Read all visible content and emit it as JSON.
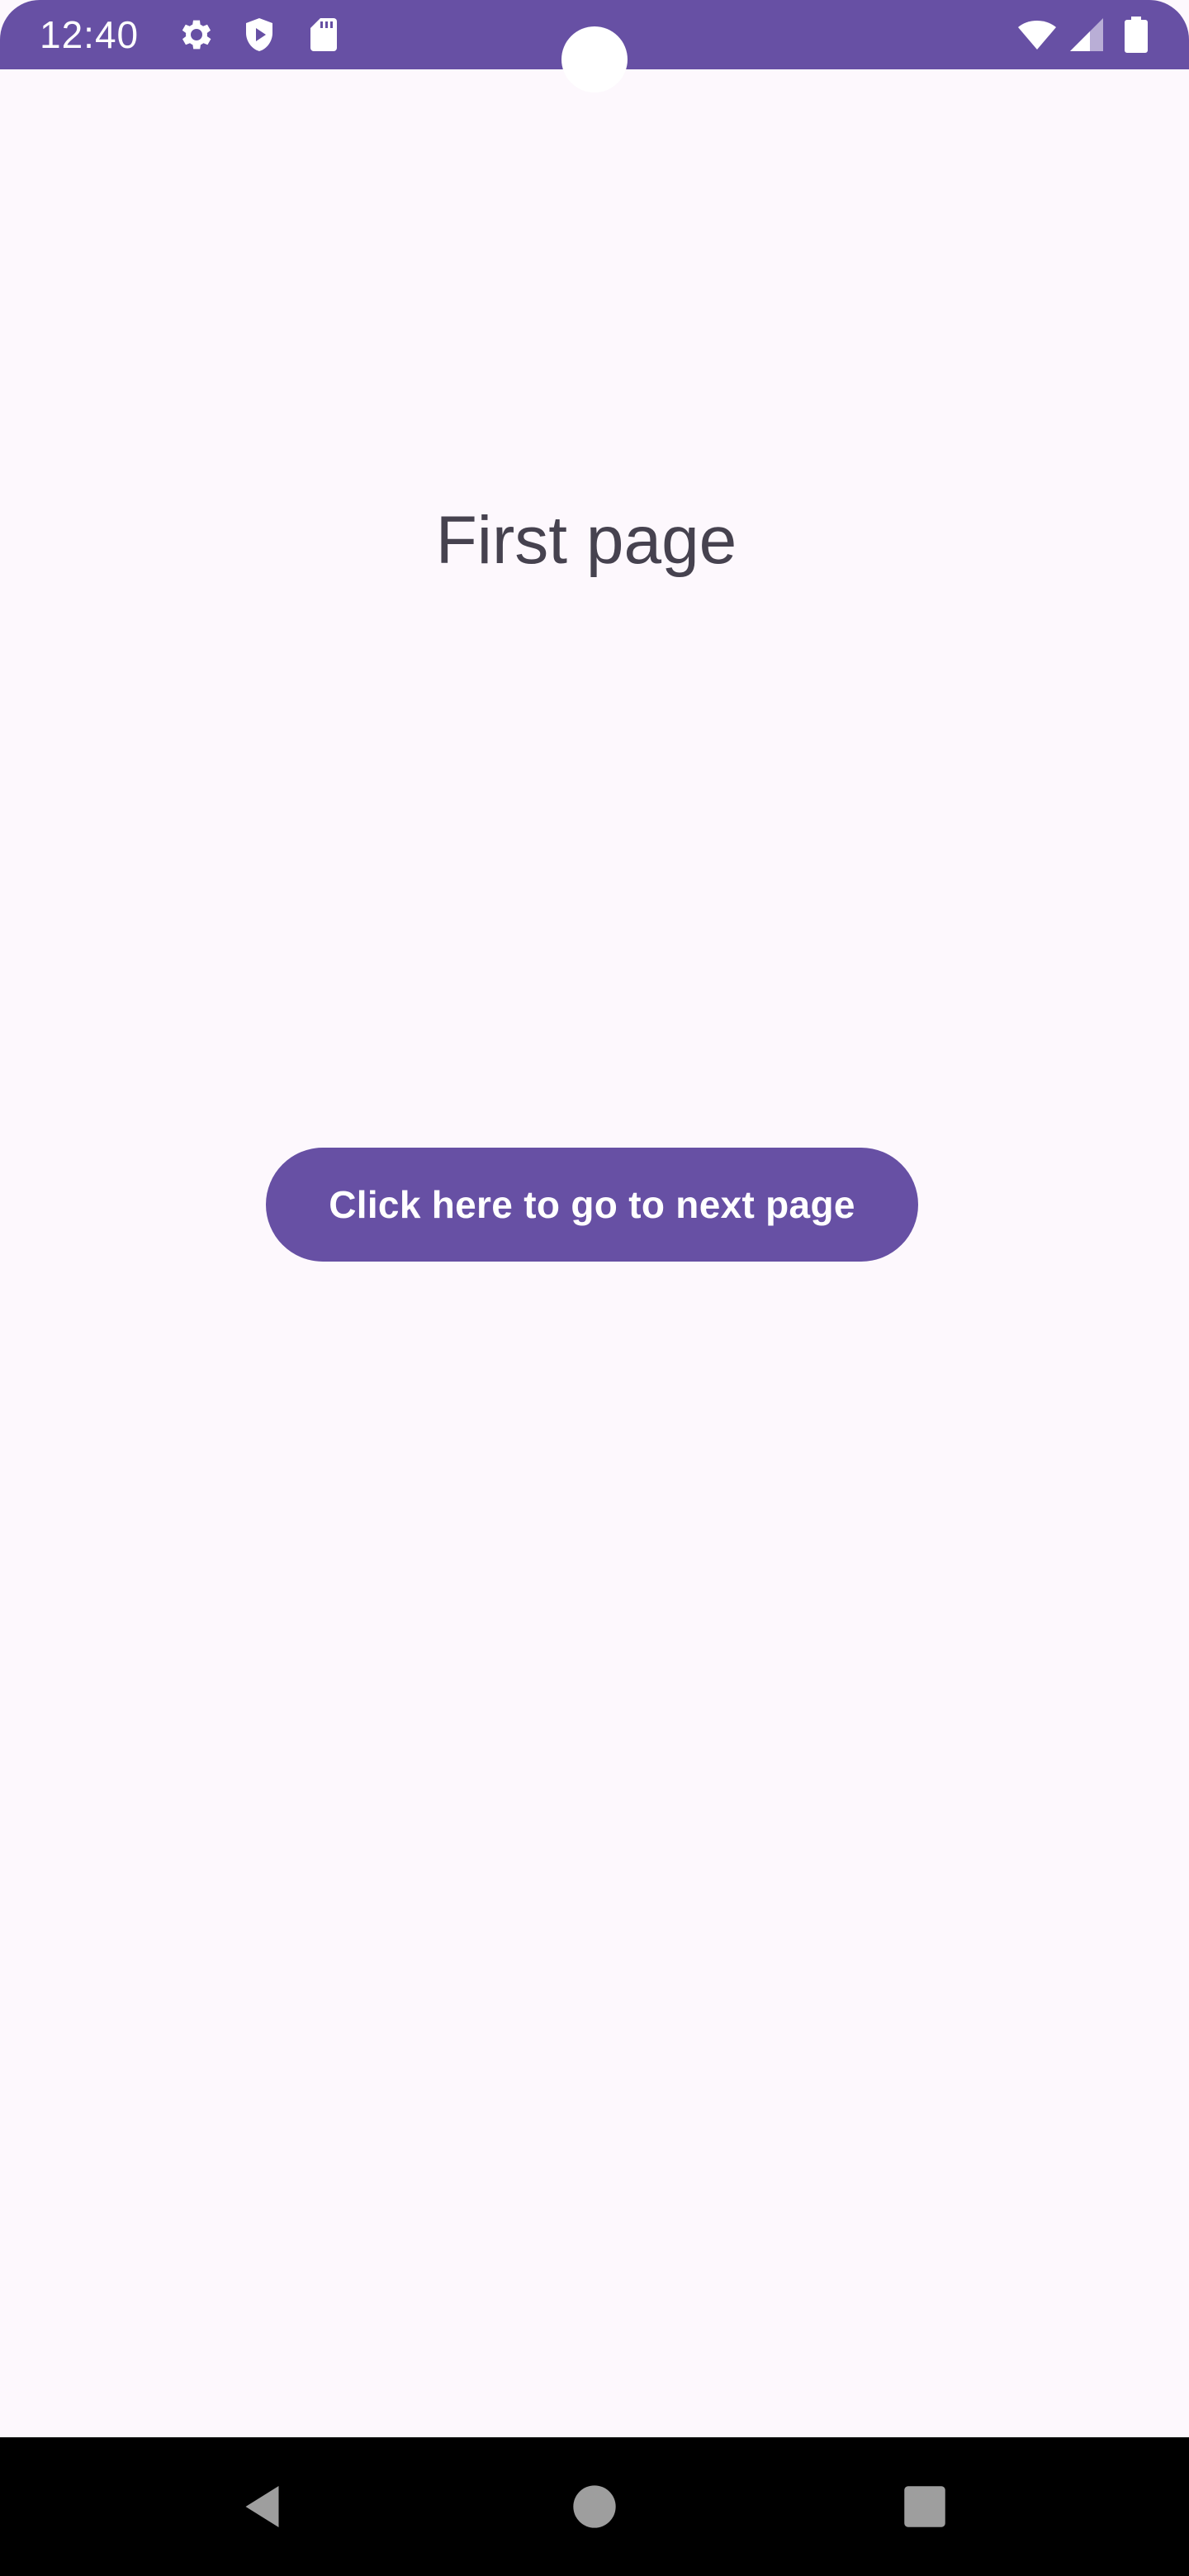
{
  "status_bar": {
    "time": "12:40",
    "left_icons": [
      "gear-icon",
      "shield-play-icon",
      "sd-card-icon"
    ],
    "right_icons": [
      "wifi-icon",
      "signal-icon",
      "battery-icon"
    ],
    "background_color": "#6750a4"
  },
  "main": {
    "title": "First page",
    "button_label": "Click here to go to next page"
  },
  "nav_bar": {
    "buttons": [
      "back",
      "home",
      "recents"
    ]
  },
  "colors": {
    "accent": "#6750a4",
    "background": "#fdf8fd",
    "title_text": "#46424f"
  }
}
